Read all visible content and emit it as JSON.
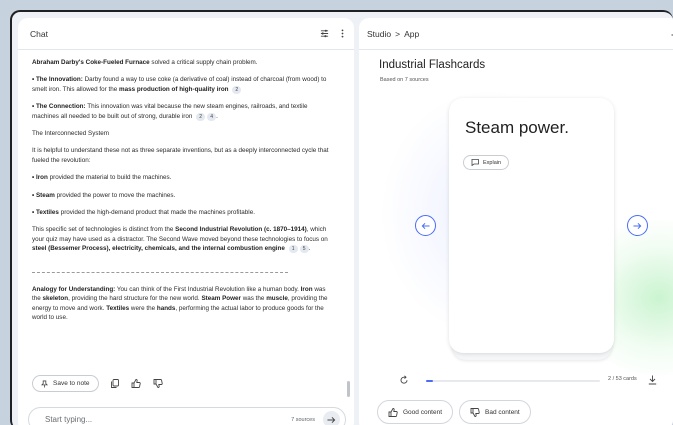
{
  "chat": {
    "title": "Chat",
    "paragraphs": {
      "p1_bold": "Abraham Darby's Coke-Fueled Furnace",
      "p1_rest": " solved a critical supply chain problem.",
      "p2_label": "• The Innovation:",
      "p2_text": " Darby found a way to use coke (a derivative of coal) instead of charcoal (from wood) to smelt iron. This allowed for the ",
      "p2_bold": "mass production of high-quality iron",
      "p2_cite": "2",
      "p3_label": "• The Connection:",
      "p3_text": " This innovation was vital because the new steam engines, railroads, and textile machines all needed to be built out of strong, durable iron",
      "p3_cite1": "2",
      "p3_cite2": "4",
      "heading": "The Interconnected System",
      "p4": "It is helpful to understand these not as three separate inventions, but as a deeply interconnected cycle that fueled the revolution:",
      "iron_label": "• Iron",
      "iron_text": " provided the material to build the machines.",
      "steam_label": "• Steam",
      "steam_text": " provided the power to move the machines.",
      "textiles_label": "• Textiles",
      "textiles_text": " provided the high-demand product that made the machines profitable.",
      "p5_a": "This specific set of technologies is distinct from the ",
      "p5_bold1": "Second Industrial Revolution (c. 1870–1914)",
      "p5_b": ", which your quiz may have used as a distractor. The Second Wave moved beyond these technologies to focus on ",
      "p5_bold2": "steel (Bessemer Process), electricity, chemicals, and the internal combustion engine",
      "p5_cite1": "1",
      "p5_cite2": "5",
      "p6_bold": "Analogy for Understanding:",
      "p6_a": " You can think of the First Industrial Revolution like a human body. ",
      "p6_iron": "Iron",
      "p6_b": " was the ",
      "p6_skeleton": "skeleton",
      "p6_c": ", providing the hard structure for the new world. ",
      "p6_steam": "Steam Power",
      "p6_d": " was the ",
      "p6_muscle": "muscle",
      "p6_e": ", providing the energy to move and work. ",
      "p6_textiles": "Textiles",
      "p6_f": " were the ",
      "p6_hands": "hands",
      "p6_g": ", performing the actual labor to produce goods for the world to use."
    },
    "save_to_note": "Save to note",
    "composer_placeholder": "Start typing...",
    "sources_count": "7 sources"
  },
  "studio": {
    "breadcrumb_root": "Studio",
    "breadcrumb_sep": ">",
    "breadcrumb_current": "App",
    "flashcards_title": "Industrial Flashcards",
    "flashcards_subtitle": "Based on 7 sources",
    "card_text": "Steam power.",
    "explain_label": "Explain",
    "card_counter": "2 / 53 cards",
    "progress_fraction": 0.038,
    "good_content": "Good content",
    "bad_content": "Bad content"
  },
  "colors": {
    "accent": "#4a6cf7",
    "page_bg": "#c7d2df"
  },
  "icons": [
    "tune-icon",
    "more-vert-icon",
    "pin-icon",
    "copy-icon",
    "thumb-up-icon",
    "thumb-down-icon",
    "arrow-right-icon",
    "expand-icon",
    "collapse-icon",
    "explain-icon",
    "arrow-left-icon",
    "reset-icon",
    "download-icon"
  ]
}
